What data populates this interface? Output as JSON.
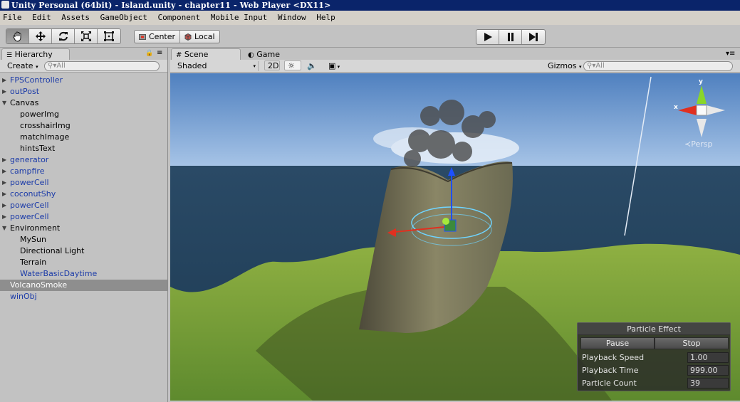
{
  "window": {
    "title": "Unity Personal (64bit) - Island.unity - chapter11 - Web Player <DX11>"
  },
  "menu": [
    "File",
    "Edit",
    "Assets",
    "GameObject",
    "Component",
    "Mobile Input",
    "Window",
    "Help"
  ],
  "toolbar": {
    "tools": [
      "hand-icon",
      "move-icon",
      "rotate-icon",
      "scale-icon",
      "rect-icon"
    ],
    "pivot_center": "Center",
    "pivot_local": "Local",
    "play": [
      "play-icon",
      "pause-icon",
      "step-icon"
    ]
  },
  "hierarchy": {
    "tab": "Hierarchy",
    "create": "Create",
    "search_placeholder": "All",
    "items": [
      {
        "label": "FPSController",
        "level": 0,
        "arrow": "collapsed",
        "prefab": true
      },
      {
        "label": "outPost",
        "level": 0,
        "arrow": "collapsed",
        "prefab": true
      },
      {
        "label": "Canvas",
        "level": 0,
        "arrow": "expanded",
        "prefab": false
      },
      {
        "label": "powerImg",
        "level": 1,
        "arrow": "",
        "prefab": false
      },
      {
        "label": "crosshairImg",
        "level": 1,
        "arrow": "",
        "prefab": false
      },
      {
        "label": "matchImage",
        "level": 1,
        "arrow": "",
        "prefab": false
      },
      {
        "label": "hintsText",
        "level": 1,
        "arrow": "",
        "prefab": false
      },
      {
        "label": "generator",
        "level": 0,
        "arrow": "collapsed",
        "prefab": true
      },
      {
        "label": "campfire",
        "level": 0,
        "arrow": "collapsed",
        "prefab": true
      },
      {
        "label": "powerCell",
        "level": 0,
        "arrow": "collapsed",
        "prefab": true
      },
      {
        "label": "coconutShy",
        "level": 0,
        "arrow": "collapsed",
        "prefab": true
      },
      {
        "label": "powerCell",
        "level": 0,
        "arrow": "collapsed",
        "prefab": true
      },
      {
        "label": "powerCell",
        "level": 0,
        "arrow": "collapsed",
        "prefab": true
      },
      {
        "label": "Environment",
        "level": 0,
        "arrow": "expanded",
        "prefab": false
      },
      {
        "label": "MySun",
        "level": 1,
        "arrow": "",
        "prefab": false
      },
      {
        "label": "Directional Light",
        "level": 1,
        "arrow": "",
        "prefab": false
      },
      {
        "label": "Terrain",
        "level": 1,
        "arrow": "",
        "prefab": false
      },
      {
        "label": "WaterBasicDaytime",
        "level": 1,
        "arrow": "",
        "prefab": true
      },
      {
        "label": "VolcanoSmoke",
        "level": 0,
        "arrow": "",
        "prefab": false,
        "selected": true
      },
      {
        "label": "winObj",
        "level": 0,
        "arrow": "",
        "prefab": true
      }
    ]
  },
  "scene": {
    "tab_scene": "Scene",
    "tab_game": "Game",
    "shading": "Shaded",
    "mode_2d": "2D",
    "gizmos": "Gizmos",
    "search_placeholder": "All",
    "persp_label": "Persp",
    "axis_y": "y",
    "axis_x": "x"
  },
  "particle_effect": {
    "title": "Particle Effect",
    "pause": "Pause",
    "stop": "Stop",
    "rows": [
      {
        "label": "Playback Speed",
        "value": "1.00"
      },
      {
        "label": "Playback Time",
        "value": "999.00"
      },
      {
        "label": "Particle Count",
        "value": "39"
      }
    ]
  }
}
